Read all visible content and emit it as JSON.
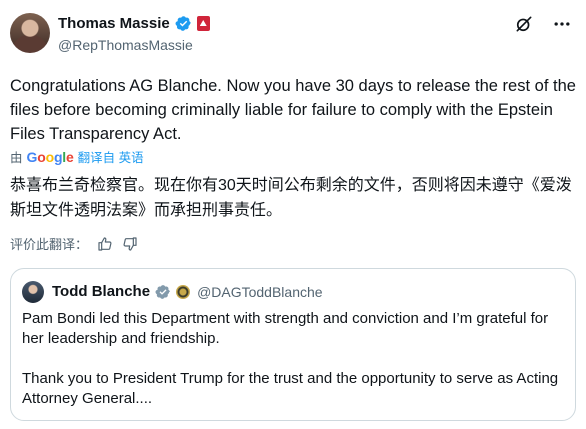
{
  "author": {
    "name": "Thomas Massie",
    "handle": "@RepThomasMassie"
  },
  "icons": {
    "verified": "verified-badge-icon",
    "affiliation": "house-flag-badge-icon",
    "grok": "grok-icon",
    "more": "more-options-icon",
    "thumbs_up": "thumbs-up-icon",
    "thumbs_down": "thumbs-down-icon"
  },
  "tweet": {
    "text": "Congratulations AG Blanche. Now you have 30 days to release the rest of the files before becoming criminally liable for failure to comply with the Epstein Files Transparency Act."
  },
  "translation": {
    "by_label": "由",
    "provider": "Google",
    "action": "翻译自 英语",
    "text": "恭喜布兰奇检察官。现在你有30天时间公布剩余的文件，否则将因未遵守《爱泼斯坦文件透明法案》而承担刑事责任。",
    "rate_label": "评价此翻译："
  },
  "quote": {
    "name": "Todd Blanche",
    "handle": "@DAGToddBlanche",
    "paragraph1": "Pam Bondi led this Department with strength and conviction and I’m grateful for her leadership and friendship.",
    "paragraph2": "Thank you to President Trump for the trust and the opportunity to serve as Acting Attorney General...."
  },
  "colors": {
    "verified_blue": "#1d9bf0",
    "text_primary": "#0f1419",
    "text_secondary": "#536471",
    "border": "#cfd9de",
    "house_badge": "#d0253a"
  }
}
